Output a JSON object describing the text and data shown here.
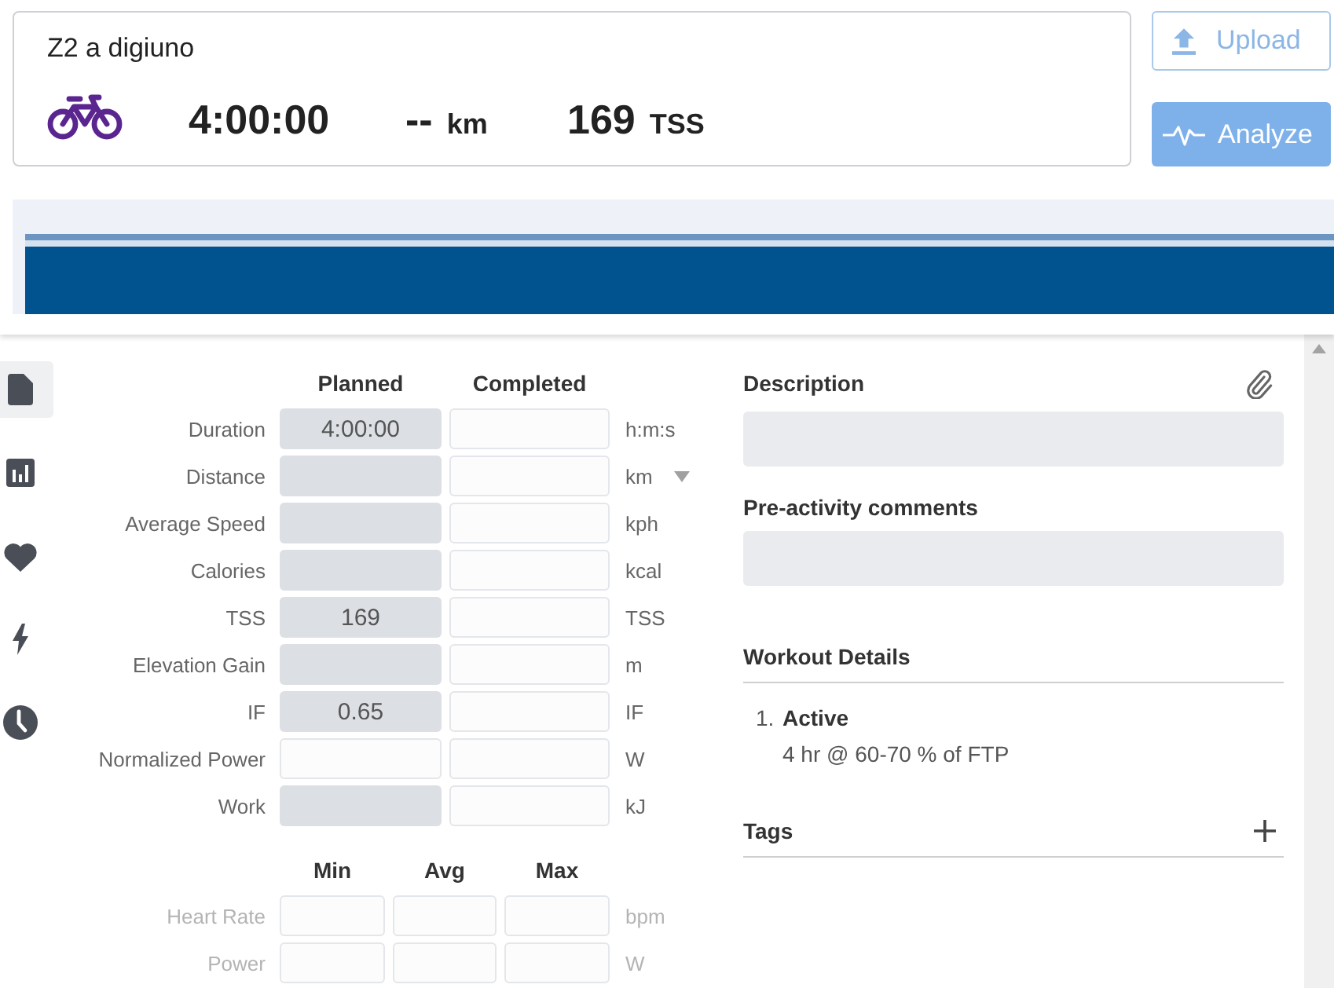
{
  "header": {
    "title": "Z2 a digiuno",
    "duration": "4:00:00",
    "distance": "--",
    "distance_unit": "km",
    "tss": "169",
    "tss_unit": "TSS"
  },
  "actions": [
    {
      "label": "Upload",
      "kind": "upload"
    },
    {
      "label": "Analyze",
      "kind": "analyze"
    }
  ],
  "sidebar": {
    "items": [
      {
        "selected": true
      },
      {
        "selected": false
      },
      {
        "selected": false
      },
      {
        "selected": false
      },
      {
        "selected": false
      }
    ]
  },
  "metrics": {
    "columns": [
      "Planned",
      "Completed"
    ],
    "rows": [
      {
        "label": "Duration",
        "planned": {
          "value": "4:00:00",
          "disabled": false
        },
        "completed": {
          "disabled": true
        },
        "unit": "h:m:s",
        "dropdown": false
      },
      {
        "label": "Distance",
        "planned": {
          "disabled": false
        },
        "completed": {
          "disabled": true
        },
        "unit": "km",
        "dropdown": true
      },
      {
        "label": "Average Speed",
        "planned": {
          "disabled": false
        },
        "completed": {
          "disabled": true
        },
        "unit": "kph",
        "dropdown": false
      },
      {
        "label": "Calories",
        "planned": {
          "disabled": false
        },
        "completed": {
          "disabled": true
        },
        "unit": "kcal",
        "dropdown": false
      },
      {
        "label": "TSS",
        "planned": {
          "value": "169",
          "disabled": false
        },
        "completed": {
          "disabled": true
        },
        "unit": "TSS",
        "dropdown": false
      },
      {
        "label": "Elevation Gain",
        "planned": {
          "disabled": false
        },
        "completed": {
          "disabled": true
        },
        "unit": "m",
        "dropdown": false
      },
      {
        "label": "IF",
        "planned": {
          "value": "0.65",
          "disabled": false
        },
        "completed": {
          "disabled": true
        },
        "unit": "IF",
        "dropdown": false
      },
      {
        "label": "Normalized Power",
        "planned": {
          "disabled": true
        },
        "completed": {
          "disabled": true
        },
        "unit": "W",
        "dropdown": false
      },
      {
        "label": "Work",
        "planned": {
          "disabled": false
        },
        "completed": {
          "disabled": true
        },
        "unit": "kJ",
        "dropdown": false
      }
    ]
  },
  "ranges": {
    "columns": [
      "Min",
      "Avg",
      "Max"
    ],
    "rows": [
      {
        "label": "Heart Rate",
        "unit": "bpm",
        "disabled": true
      },
      {
        "label": "Power",
        "unit": "W",
        "disabled": true
      }
    ]
  },
  "description": {
    "label": "Description"
  },
  "pre_activity_comments": {
    "label": "Pre-activity comments"
  },
  "workout_details": {
    "title": "Workout Details",
    "steps": [
      {
        "number": "1.",
        "name": "Active",
        "detail": "4 hr @ 60-70 % of FTP"
      }
    ]
  },
  "tags": {
    "title": "Tags"
  }
}
